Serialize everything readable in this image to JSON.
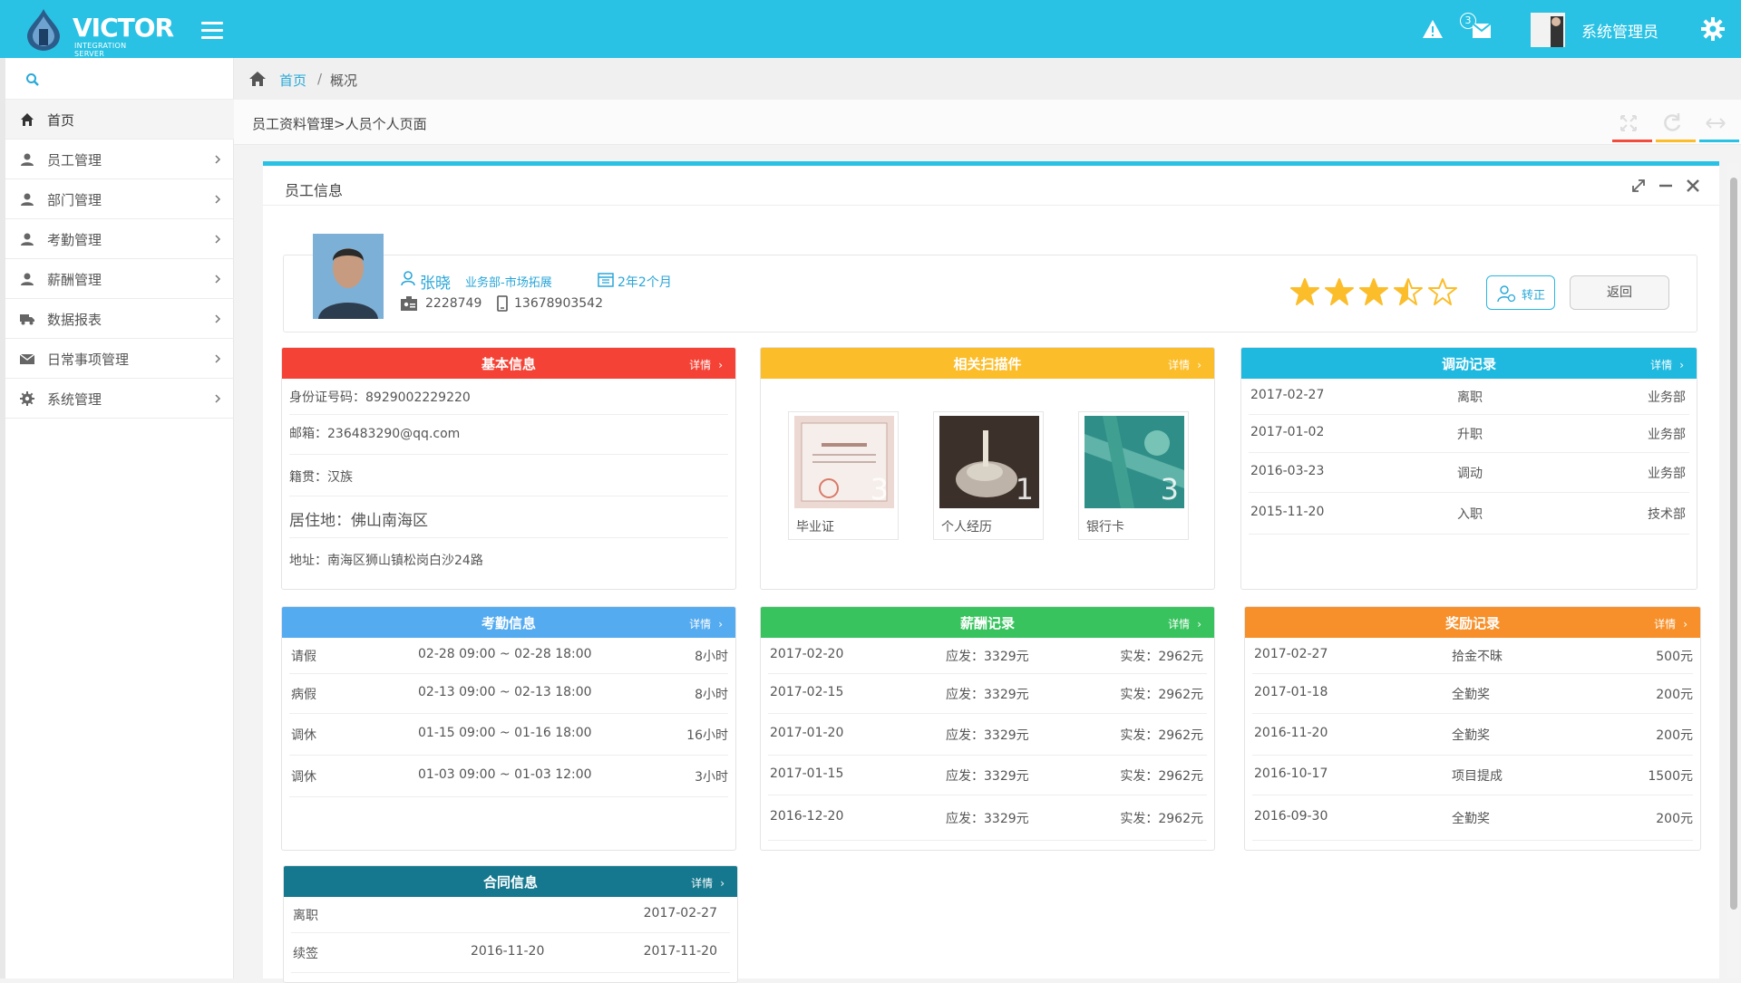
{
  "app": {
    "logo_text": "VICTOR",
    "logo_sub": "INTEGRATION SERVER",
    "user_name": "系统管理员",
    "message_count": "3"
  },
  "colors": {
    "primary": "#29c2e4",
    "red": "#f44336",
    "yellow": "#fbbd2a",
    "cyan": "#1fb9e0",
    "blue": "#55abef",
    "green": "#39c35f",
    "orange": "#f7902a",
    "teal": "#15788e",
    "link": "#2aa6d8"
  },
  "sidebar": {
    "items": [
      {
        "label": "首页",
        "icon": "home-icon"
      },
      {
        "label": "员工管理",
        "icon": "user-icon"
      },
      {
        "label": "部门管理",
        "icon": "user-icon"
      },
      {
        "label": "考勤管理",
        "icon": "user-icon"
      },
      {
        "label": "薪酬管理",
        "icon": "user-icon"
      },
      {
        "label": "数据报表",
        "icon": "truck-icon"
      },
      {
        "label": "日常事项管理",
        "icon": "envelope-icon"
      },
      {
        "label": "系统管理",
        "icon": "gear-icon"
      }
    ]
  },
  "breadcrumb": {
    "home": "首页",
    "sep": "/",
    "current": "概况"
  },
  "path": "员工资料管理>人员个人页面",
  "panel": {
    "title": "员工信息"
  },
  "profile": {
    "name": "张晓",
    "department": "业务部-市场拓展",
    "tenure": "2年2个月",
    "employee_id": "2228749",
    "phone": "13678903542",
    "rating": 3.5,
    "rating_max": 5,
    "transfer_label": "转正",
    "back_label": "返回"
  },
  "more_label": "详情",
  "basic": {
    "title": "基本信息",
    "rows": [
      "身份证号码：8929002229220",
      "邮箱：236483290@qq.com",
      "籍贯：汉族",
      "居住地：佛山南海区",
      "地址：南海区狮山镇松岗白沙24路"
    ]
  },
  "scans": {
    "title": "相关扫描件",
    "items": [
      {
        "caption": "毕业证",
        "number": "3"
      },
      {
        "caption": "个人经历",
        "number": "1"
      },
      {
        "caption": "银行卡",
        "number": "3"
      }
    ]
  },
  "transfer": {
    "title": "调动记录",
    "rows": [
      {
        "date": "2017-02-27",
        "type": "离职",
        "dept": "业务部"
      },
      {
        "date": "2017-01-02",
        "type": "升职",
        "dept": "业务部"
      },
      {
        "date": "2016-03-23",
        "type": "调动",
        "dept": "业务部"
      },
      {
        "date": "2015-11-20",
        "type": "入职",
        "dept": "技术部"
      }
    ]
  },
  "attendance": {
    "title": "考勤信息",
    "rows": [
      {
        "type": "请假",
        "range": "02-28  09:00 ~ 02-28  18:00",
        "hours": "8小时"
      },
      {
        "type": "病假",
        "range": "02-13  09:00 ~ 02-13  18:00",
        "hours": "8小时"
      },
      {
        "type": "调休",
        "range": "01-15  09:00 ~ 01-16  18:00",
        "hours": "16小时"
      },
      {
        "type": "调休",
        "range": "01-03  09:00 ~ 01-03  12:00",
        "hours": "3小时"
      }
    ]
  },
  "salary": {
    "title": "薪酬记录",
    "rows": [
      {
        "date": "2017-02-20",
        "gross": "应发：3329元",
        "net": "实发：2962元"
      },
      {
        "date": "2017-02-15",
        "gross": "应发：3329元",
        "net": "实发：2962元"
      },
      {
        "date": "2017-01-20",
        "gross": "应发：3329元",
        "net": "实发：2962元"
      },
      {
        "date": "2017-01-15",
        "gross": "应发：3329元",
        "net": "实发：2962元"
      },
      {
        "date": "2016-12-20",
        "gross": "应发：3329元",
        "net": "实发：2962元"
      }
    ]
  },
  "rewards": {
    "title": "奖励记录",
    "rows": [
      {
        "date": "2017-02-27",
        "name": "拾金不昧",
        "amount": "500元"
      },
      {
        "date": "2017-01-18",
        "name": "全勤奖",
        "amount": "200元"
      },
      {
        "date": "2016-11-20",
        "name": "全勤奖",
        "amount": "200元"
      },
      {
        "date": "2016-10-17",
        "name": "项目提成",
        "amount": "1500元"
      },
      {
        "date": "2016-09-30",
        "name": "全勤奖",
        "amount": "200元"
      }
    ]
  },
  "contract": {
    "title": "合同信息",
    "rows": [
      {
        "type": "离职",
        "start": "",
        "end": "2017-02-27"
      },
      {
        "type": "续签",
        "start": "2016-11-20",
        "end": "2017-11-20"
      }
    ]
  }
}
